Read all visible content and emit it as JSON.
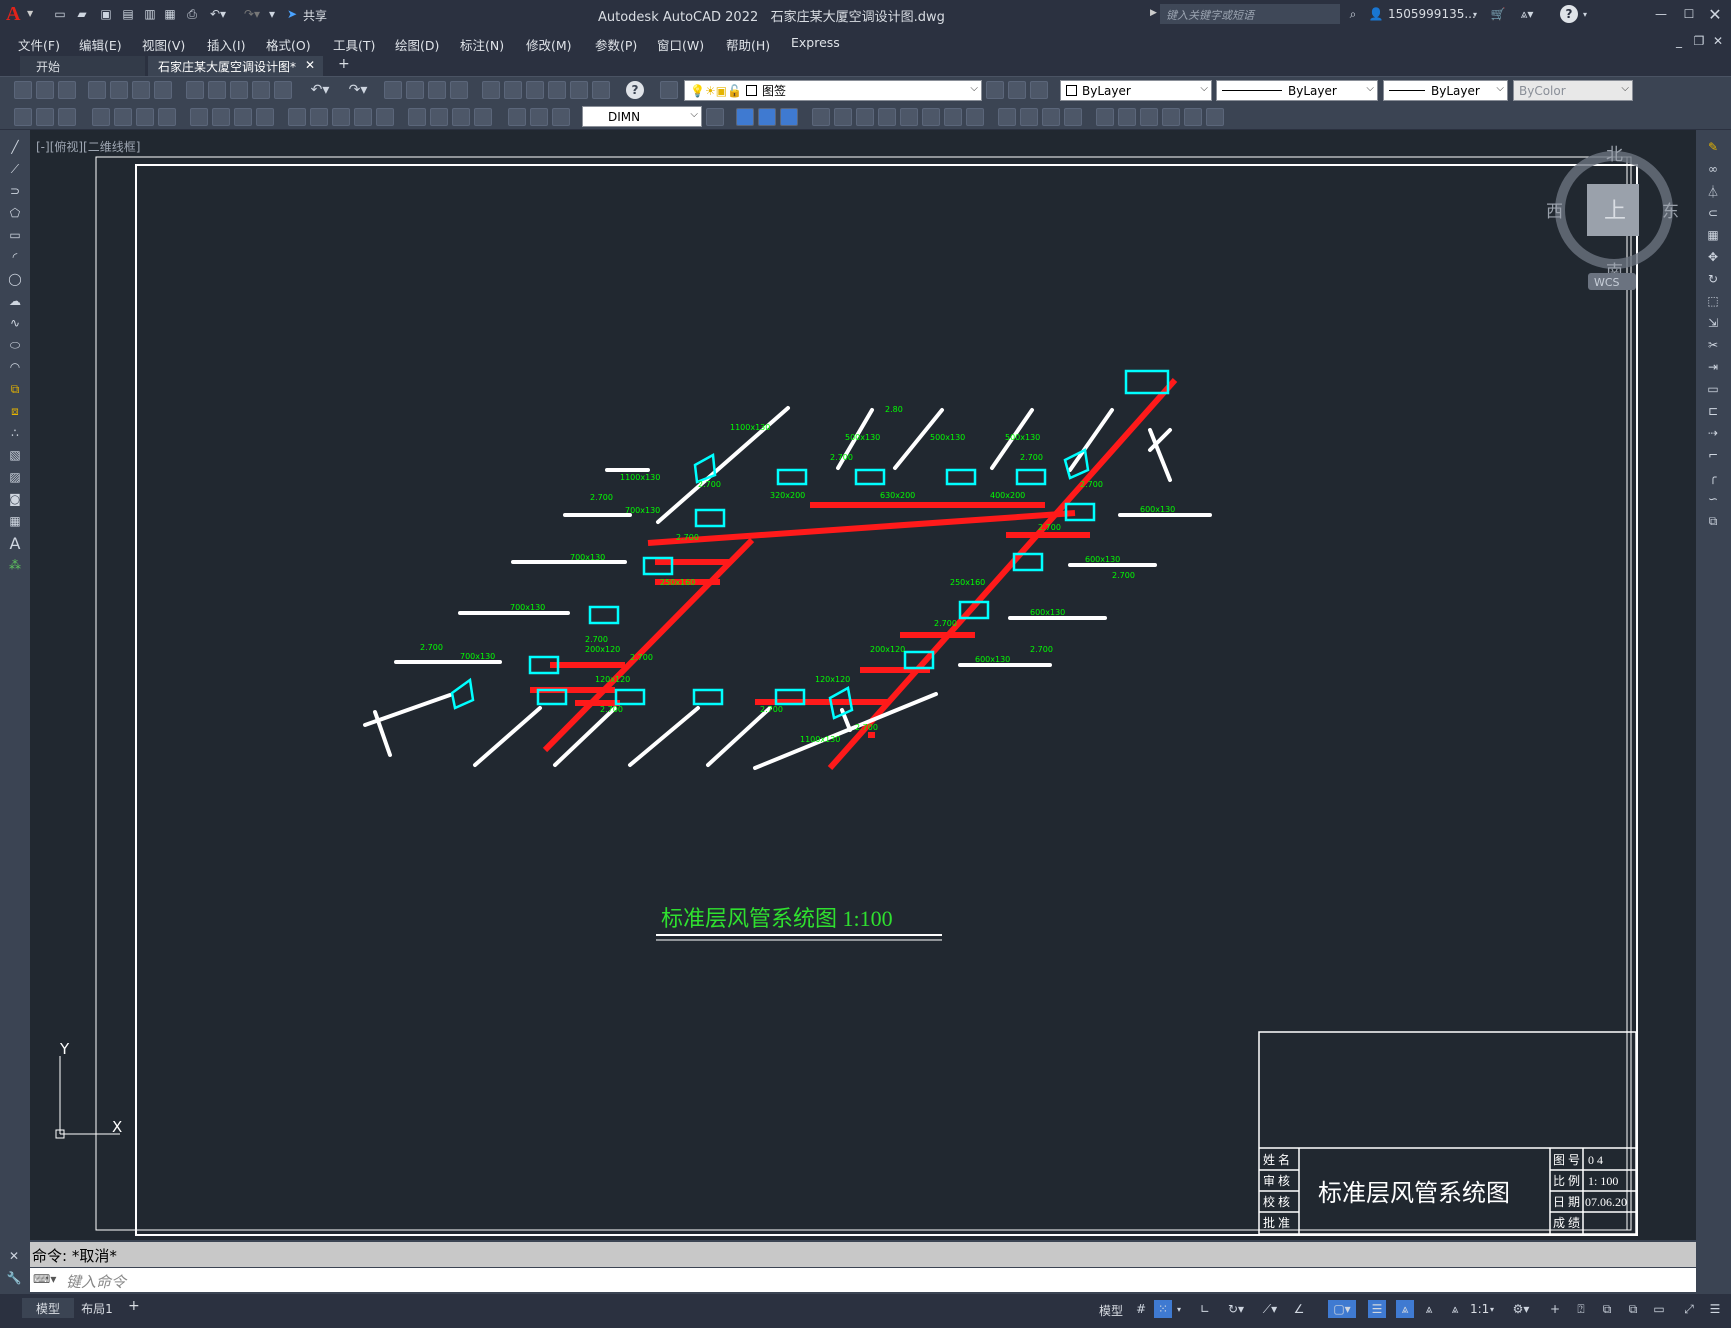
{
  "app": {
    "name": "Autodesk AutoCAD 2022",
    "file": "石家庄某大厦空调设计图.dwg",
    "share_label": "共享",
    "search_placeholder": "键入关键字或短语",
    "user": "1505999135..."
  },
  "menu": [
    "文件(F)",
    "编辑(E)",
    "视图(V)",
    "插入(I)",
    "格式(O)",
    "工具(T)",
    "绘图(D)",
    "标注(N)",
    "修改(M)",
    "参数(P)",
    "窗口(W)",
    "帮助(H)",
    "Express"
  ],
  "tabs": {
    "start": "开始",
    "active": "石家庄某大厦空调设计图*",
    "add": "+"
  },
  "toolbar": {
    "layer": "图签",
    "color": "ByLayer",
    "linetype": "ByLayer",
    "lineweight": "ByLayer",
    "plotstyle": "ByColor",
    "dimstyle": "DIMN"
  },
  "viewport": {
    "label": "[-][俯视][二维线框]",
    "viewcube": {
      "n": "北",
      "s": "南",
      "e": "东",
      "w": "西",
      "top": "上",
      "wcs": "WCS"
    },
    "ucs_y": "Y",
    "ucs_x": "X"
  },
  "drawing": {
    "title": "标准层风管系统图 1:100",
    "titleblock": {
      "main": "标准层风管系统图",
      "left": [
        "姓 名",
        "审 核",
        "校 核",
        "批 准"
      ],
      "right_labels": [
        "图 号",
        "比 例",
        "日 期",
        "成 绩"
      ],
      "right_values": [
        "0 4",
        "1: 100",
        "07.06.20",
        ""
      ]
    },
    "labels": {
      "dim_2700": "2.700",
      "dim_280": "2.80",
      "s700": "700x130",
      "s600": "600x130",
      "s1100": "1100x130",
      "s500": "500x130",
      "s120": "120x120",
      "s200": "200x120",
      "s250": "250x160",
      "s320": "320x200",
      "s400": "400x200",
      "s630": "630x200"
    }
  },
  "command": {
    "history": "命令: *取消*",
    "placeholder": "键入命令"
  },
  "status": {
    "model_tab": "模型",
    "layout_tab": "布局1",
    "add": "+",
    "model": "模型",
    "scale": "1:1"
  }
}
